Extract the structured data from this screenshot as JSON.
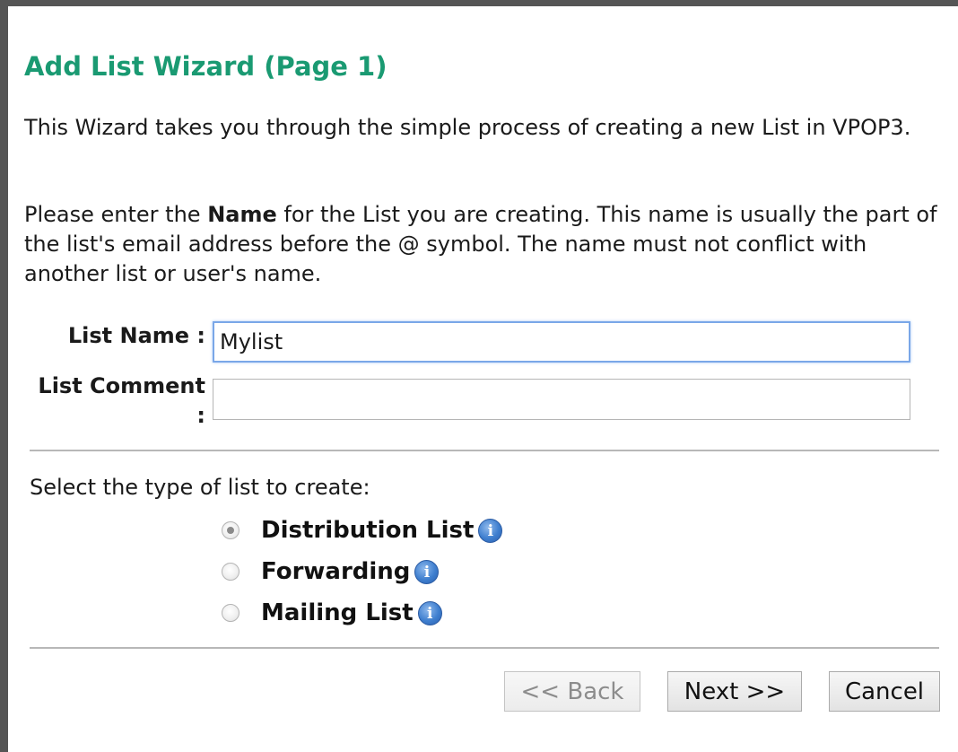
{
  "wizard": {
    "title": "Add List Wizard (Page 1)",
    "intro": "This Wizard takes you through the simple process of creating a new List in VPOP3.",
    "instruction_before": "Please enter the ",
    "instruction_bold": "Name",
    "instruction_after": " for the List you are creating. This name is usually the part of the list's email address before the @ symbol. The name must not conflict with another list or user's name."
  },
  "fields": {
    "list_name_label": "List Name :",
    "list_name_value": "Mylist",
    "list_comment_label": "List Comment :",
    "list_comment_value": ""
  },
  "list_type": {
    "prompt": "Select the type of list to create:",
    "options": [
      {
        "label": "Distribution List",
        "selected": true,
        "icon": "info-icon"
      },
      {
        "label": "Forwarding",
        "selected": false,
        "icon": "info-icon"
      },
      {
        "label": "Mailing List",
        "selected": false,
        "icon": "info-icon"
      }
    ],
    "info_glyph": "i"
  },
  "buttons": {
    "back": "<< Back",
    "next": "Next >>",
    "cancel": "Cancel"
  },
  "colors": {
    "title": "#1a9a72",
    "frame": "#555555",
    "focus_border": "#7aa7e8",
    "info_icon": "#3f7fcf"
  }
}
